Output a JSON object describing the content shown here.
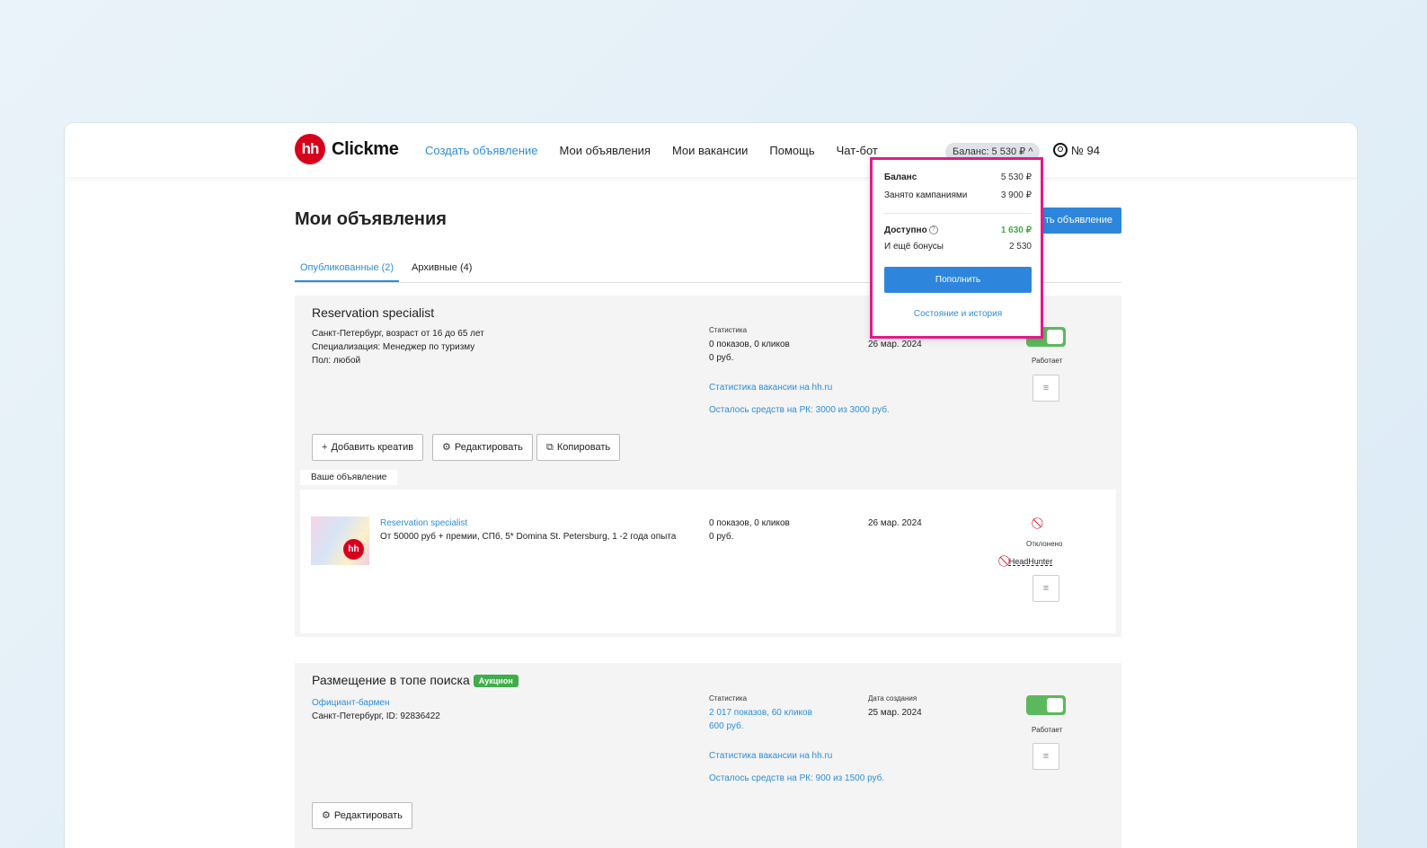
{
  "header": {
    "logo_mark": "hh",
    "logo_text": "Clickme",
    "nav": [
      "Создать объявление",
      "Мои объявления",
      "Мои вакансии",
      "Помощь",
      "Чат-бот"
    ],
    "balance_pill": "Баланс: 5 530 ₽  ^",
    "account_label": "№ 94"
  },
  "page": {
    "title": "Мои объявления",
    "create_button": "ть объявление",
    "tabs": [
      "Опубликованные (2)",
      "Архивные (4)"
    ]
  },
  "balance_popup": {
    "balance_label": "Баланс",
    "balance_value": "5 530 ₽",
    "busy_label": "Занято кампаниями",
    "busy_value": "3 900 ₽",
    "available_label": "Доступно",
    "available_value": "1 630 ₽",
    "bonus_label": "И ещё бонусы",
    "bonus_value": "2 530",
    "topup_button": "Пополнить",
    "history_link": "Состояние и история"
  },
  "card1": {
    "title": "Reservation specialist",
    "details": [
      "Санкт-Петербург, возраст от 16 до 65 лет",
      "Специализация: Менеджер по туризму",
      "Пол: любой"
    ],
    "stats_label": "Статистика",
    "stats": [
      "0 показов, 0 кликов",
      "0 руб."
    ],
    "date": "26 мар. 2024",
    "link_stats": "Статистика вакансии на hh.ru",
    "link_funds": "Осталось средств на РК: 3000 из 3000 руб.",
    "status": "Работает",
    "buttons": [
      "Добавить креатив",
      "Редактировать",
      "Копировать"
    ],
    "ad_section_label": "Ваше объявление",
    "ad": {
      "thumb_mark": "hh",
      "title": "Reservation specialist",
      "desc": "От 50000 руб + премии, СПб, 5* Domina St. Petersburg, 1 -2 года опыта",
      "stats": [
        "0 показов, 0 кликов",
        "0 руб."
      ],
      "date": "26 мар. 2024",
      "status": "Отклонено",
      "moderator": "HeadHunter"
    }
  },
  "card2": {
    "title": "Размещение в топе поиска",
    "badge": "Аукцион",
    "vacancy_link": "Официант-бармен",
    "location": "Санкт-Петербург, ID: 92836422",
    "stats_label": "Статистика",
    "stats": [
      "2 017 показов, 60 кликов",
      "600 руб."
    ],
    "date_label": "Дата создания",
    "date": "25 мар. 2024",
    "link_stats": "Статистика вакансии на hh.ru",
    "link_funds": "Осталось средств на РК: 900 из 1500 руб.",
    "status": "Работает",
    "edit_button": "Редактировать"
  },
  "colors": {
    "accent": "#2d86dc",
    "brand": "#d6001c",
    "success": "#3fae4a",
    "highlight": "#e4198a"
  }
}
